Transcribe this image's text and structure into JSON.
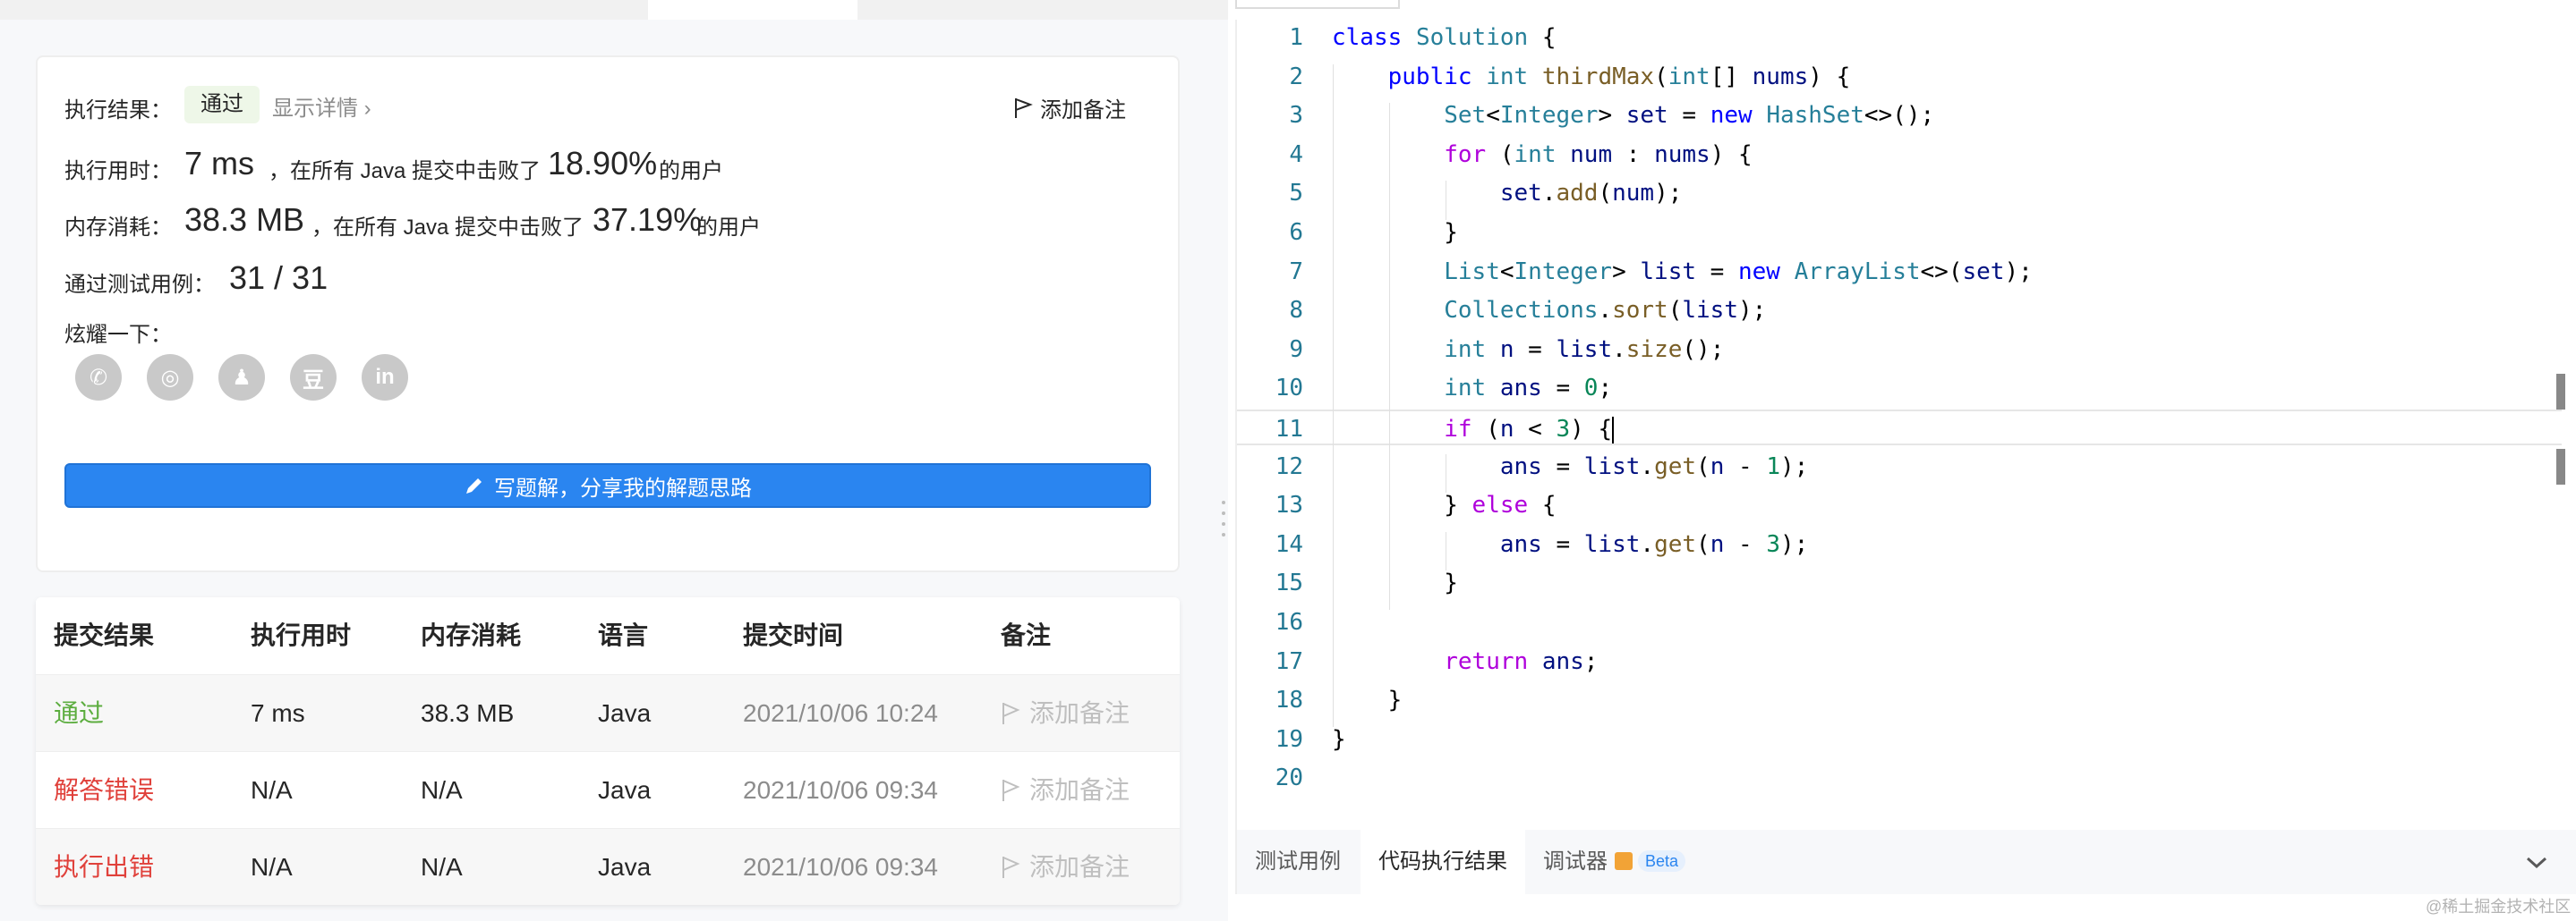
{
  "result": {
    "label": "执行结果：",
    "status": "通过",
    "detail_link": "显示详情 ›",
    "add_note": "添加备注",
    "runtime_label": "执行用时：",
    "runtime_value": "7 ms",
    "runtime_mid": "，在所有 Java 提交中击败了",
    "runtime_percent": "18.90%",
    "runtime_suffix": "的用户",
    "memory_label": "内存消耗：",
    "memory_value": "38.3 MB",
    "memory_mid": "，在所有 Java 提交中击败了",
    "memory_percent": "37.19%",
    "memory_suffix": "的用户",
    "tests_label": "通过测试用例：",
    "tests_value": "31 / 31",
    "share_label": "炫耀一下：",
    "share_icons": [
      "wechat-icon",
      "weibo-icon",
      "qq-icon",
      "douban-icon",
      "linkedin-icon"
    ],
    "share_glyphs": [
      "✆",
      "◎",
      "♟",
      "豆",
      "in"
    ],
    "write_button": "写题解，分享我的解题思路"
  },
  "submissions": {
    "headers": [
      "提交结果",
      "执行用时",
      "内存消耗",
      "语言",
      "提交时间",
      "备注"
    ],
    "rows": [
      {
        "status": "通过",
        "runtime": "7 ms",
        "memory": "38.3 MB",
        "language": "Java",
        "time": "2021/10/06 10:24",
        "note": "添加备注"
      },
      {
        "status": "解答错误",
        "runtime": "N/A",
        "memory": "N/A",
        "language": "Java",
        "time": "2021/10/06 09:34",
        "note": "添加备注"
      },
      {
        "status": "执行出错",
        "runtime": "N/A",
        "memory": "N/A",
        "language": "Java",
        "time": "2021/10/06 09:34",
        "note": "添加备注"
      }
    ]
  },
  "editor": {
    "line_numbers": [
      "1",
      "2",
      "3",
      "4",
      "5",
      "6",
      "7",
      "8",
      "9",
      "10",
      "11",
      "12",
      "13",
      "14",
      "15",
      "16",
      "17",
      "18",
      "19",
      "20"
    ],
    "lines": [
      "class Solution {",
      "    public int thirdMax(int[] nums) {",
      "        Set<Integer> set = new HashSet<>();",
      "        for (int num : nums) {",
      "            set.add(num);",
      "        }",
      "        List<Integer> list = new ArrayList<>(set);",
      "        Collections.sort(list);",
      "        int n = list.size();",
      "        int ans = 0;",
      "        if (n < 3) {",
      "            ans = list.get(n - 1);",
      "        } else {",
      "            ans = list.get(n - 3);",
      "        }",
      "",
      "        return ans;",
      "    }",
      "}",
      ""
    ],
    "current_line": 11
  },
  "bottom_tabs": {
    "testcase": "测试用例",
    "result": "代码执行结果",
    "debugger": "调试器",
    "beta": "Beta"
  },
  "watermark": "@稀土掘金技术社区",
  "colors": {
    "accent": "#2a85f0",
    "pass": "#5cad3f",
    "fail": "#e0413b"
  }
}
